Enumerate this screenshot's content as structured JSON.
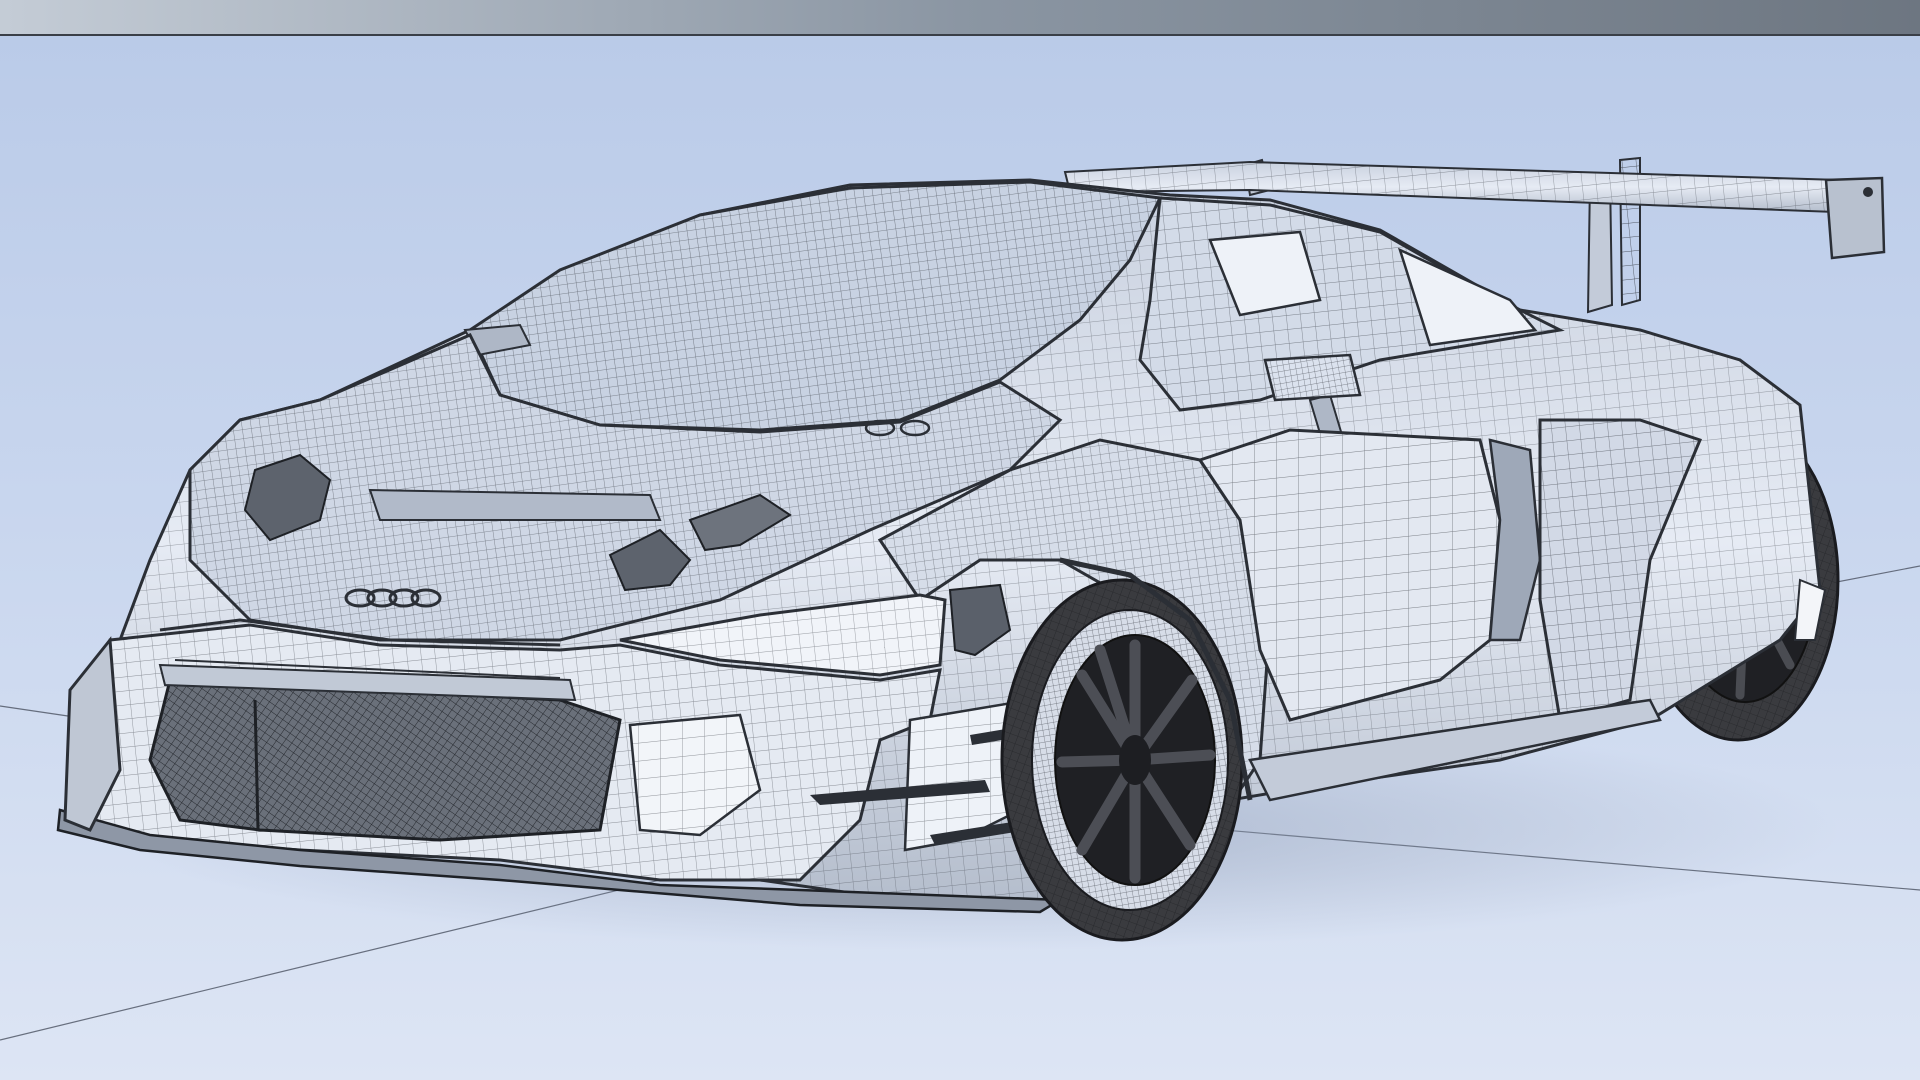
{
  "scene": {
    "subject": "audi-r8-lms-gt3-wireframe",
    "view": "front-three-quarter",
    "render_mode": "wireframe-on-shaded",
    "colors": {
      "background_top": "#b9cae8",
      "background_mid": "#cbd8ef",
      "floor": "#dde5f4",
      "floor_far": "#c9d6ee",
      "top_band": "#9aa4ae",
      "body_fill": "#dfe6f2",
      "body_shade": "#aeb7c6",
      "wire": "#2b2f36",
      "tire": "#3a3b3f",
      "rim": "#1f2024",
      "glass": "#c8d2e2"
    },
    "icons": [
      "four-rings-logo-icon"
    ]
  }
}
